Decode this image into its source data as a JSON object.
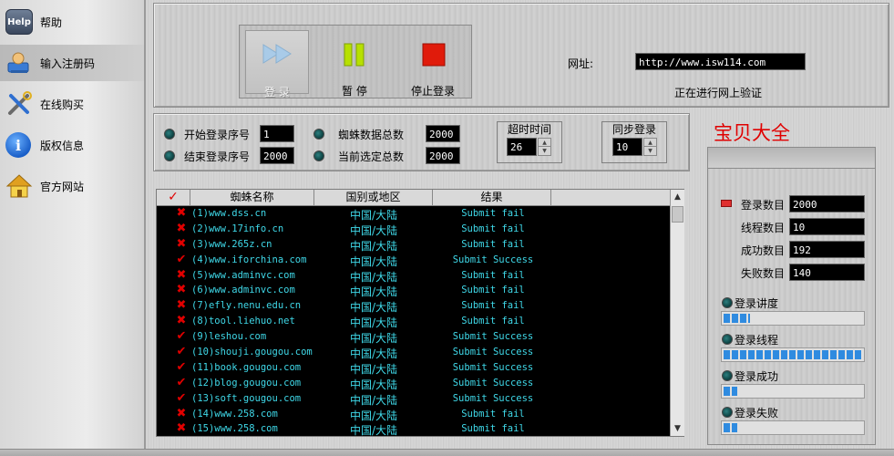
{
  "sidebar": {
    "items": [
      {
        "label": "帮助",
        "icon": "help-icon"
      },
      {
        "label": "输入注册码",
        "icon": "user-login-icon"
      },
      {
        "label": "在线购买",
        "icon": "tools-icon"
      },
      {
        "label": "版权信息",
        "icon": "info-icon"
      },
      {
        "label": "官方网站",
        "icon": "home-icon"
      }
    ],
    "help_icon_text": "Help"
  },
  "toolbar": {
    "login_label": "登 录",
    "pause_label": "暂 停",
    "stop_label": "停止登录"
  },
  "url": {
    "label": "网址:",
    "value": "http://www.isw114.com",
    "status": "正在进行网上验证"
  },
  "settings": {
    "start_seq_label": "开始登录序号",
    "start_seq_value": "1",
    "end_seq_label": "结束登录序号",
    "end_seq_value": "2000",
    "spider_total_label": "蜘蛛数据总数",
    "spider_total_value": "2000",
    "selected_total_label": "当前选定总数",
    "selected_total_value": "2000",
    "timeout_title": "超时时间",
    "timeout_value": "26",
    "sync_title": "同步登录",
    "sync_value": "10"
  },
  "brand_title": "宝贝大全",
  "table": {
    "headers": [
      "✓",
      "蜘蛛名称",
      "国别或地区",
      "结果"
    ],
    "rows": [
      {
        "ok": false,
        "name": "(1)www.dss.cn",
        "region": "中国/大陆",
        "result": "Submit fail"
      },
      {
        "ok": false,
        "name": "(2)www.17info.cn",
        "region": "中国/大陆",
        "result": "Submit fail"
      },
      {
        "ok": false,
        "name": "(3)www.265z.cn",
        "region": "中国/大陆",
        "result": "Submit fail"
      },
      {
        "ok": true,
        "name": "(4)www.iforchina.com",
        "region": "中国/大陆",
        "result": "Submit Success"
      },
      {
        "ok": false,
        "name": "(5)www.adminvc.com",
        "region": "中国/大陆",
        "result": "Submit fail"
      },
      {
        "ok": false,
        "name": "(6)www.adminvc.com",
        "region": "中国/大陆",
        "result": "Submit fail"
      },
      {
        "ok": false,
        "name": "(7)efly.nenu.edu.cn",
        "region": "中国/大陆",
        "result": "Submit fail"
      },
      {
        "ok": false,
        "name": "(8)tool.liehuo.net",
        "region": "中国/大陆",
        "result": "Submit fail"
      },
      {
        "ok": true,
        "name": "(9)leshou.com",
        "region": "中国/大陆",
        "result": "Submit Success"
      },
      {
        "ok": true,
        "name": "(10)shouji.gougou.com",
        "region": "中国/大陆",
        "result": "Submit Success"
      },
      {
        "ok": true,
        "name": "(11)book.gougou.com",
        "region": "中国/大陆",
        "result": "Submit Success"
      },
      {
        "ok": true,
        "name": "(12)blog.gougou.com",
        "region": "中国/大陆",
        "result": "Submit Success"
      },
      {
        "ok": true,
        "name": "(13)soft.gougou.com",
        "region": "中国/大陆",
        "result": "Submit Success"
      },
      {
        "ok": false,
        "name": "(14)www.258.com",
        "region": "中国/大陆",
        "result": "Submit fail"
      },
      {
        "ok": false,
        "name": "(15)www.258.com",
        "region": "中国/大陆",
        "result": "Submit fail"
      }
    ]
  },
  "stats": {
    "login_count_label": "登录数目",
    "login_count_value": "2000",
    "thread_count_label": "线程数目",
    "thread_count_value": "10",
    "success_count_label": "成功数目",
    "success_count_value": "192",
    "fail_count_label": "失败数目",
    "fail_count_value": "140"
  },
  "progress": {
    "progress_label": "登录讲度",
    "progress_fraction": 0.19,
    "thread_label": "登录线程",
    "thread_fraction": 1.0,
    "success_label": "登录成功",
    "success_fraction": 0.1,
    "fail_label": "登录失败",
    "fail_fraction": 0.1
  },
  "colors": {
    "check": "#e00000",
    "cross": "#e00000",
    "row_text": "#3fd8e8",
    "brand_red": "#e00000",
    "bar_blue": "#2f8be0"
  }
}
